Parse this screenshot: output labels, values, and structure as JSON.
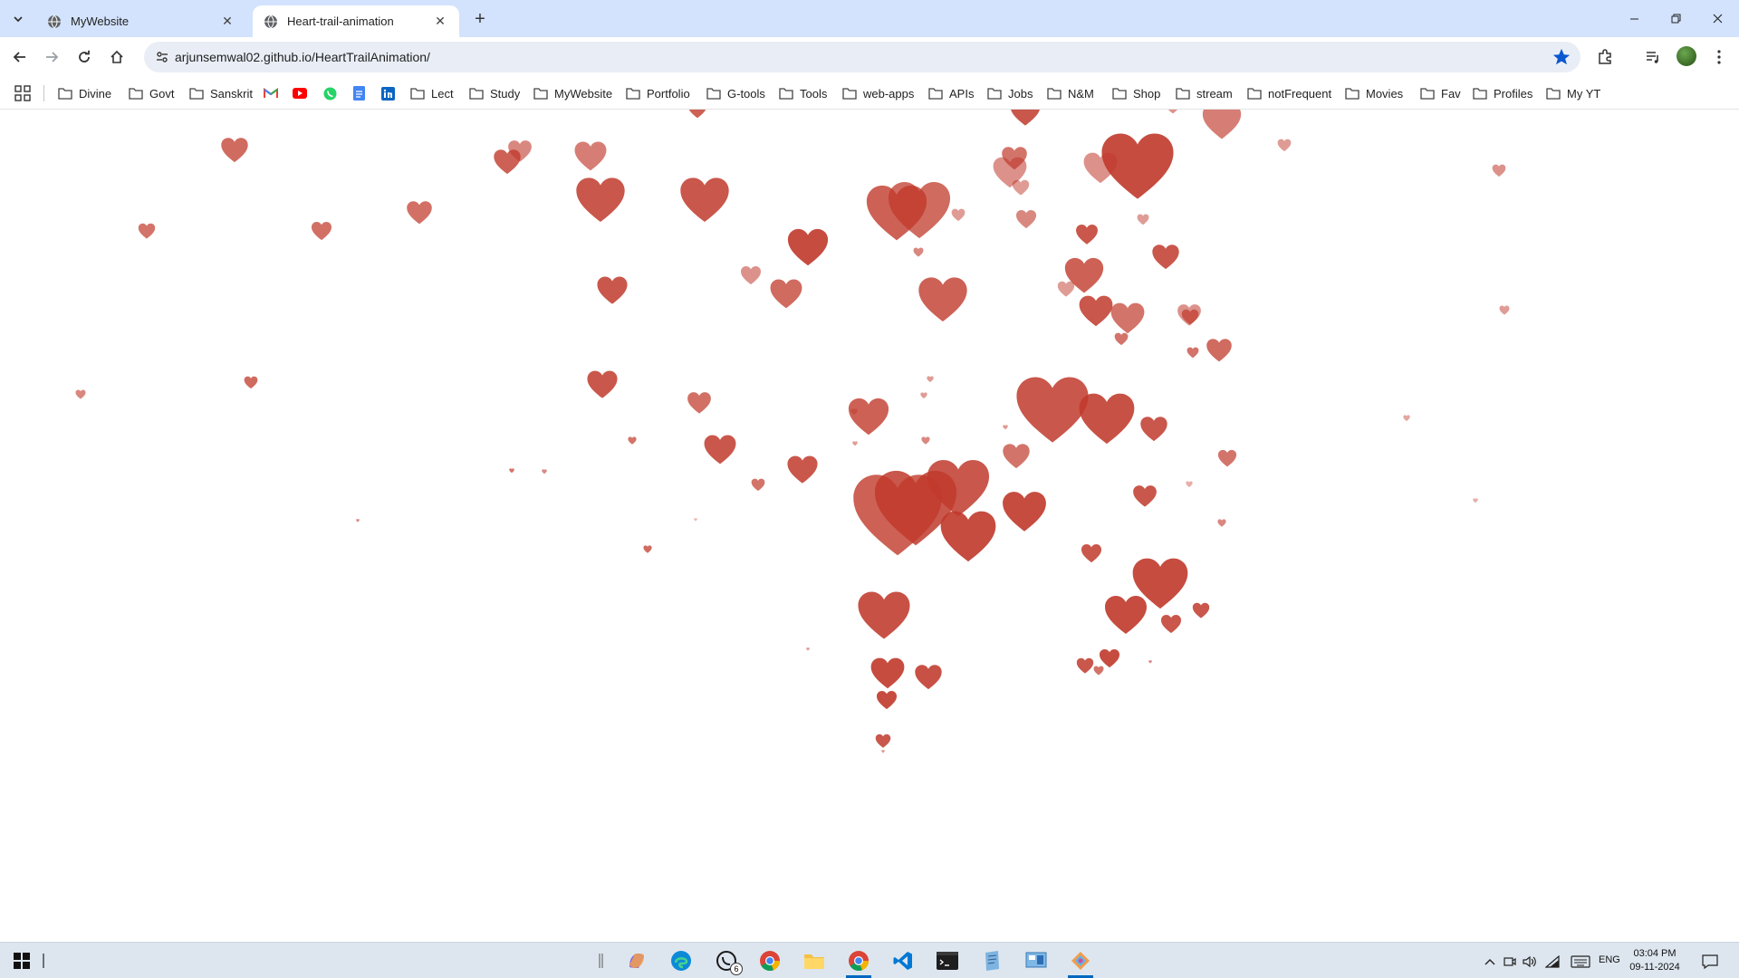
{
  "browser": {
    "tabs": [
      {
        "title": "MyWebsite",
        "active": false
      },
      {
        "title": "Heart-trail-animation",
        "active": true
      }
    ],
    "url": "arjunsemwal02.github.io/HeartTrailAnimation/",
    "bookmarks": [
      {
        "label": "Divine",
        "type": "folder"
      },
      {
        "label": "Govt",
        "type": "folder"
      },
      {
        "label": "Sanskrit",
        "type": "folder"
      },
      {
        "label": "Lect",
        "type": "folder"
      },
      {
        "label": "Study",
        "type": "folder"
      },
      {
        "label": "MyWebsite",
        "type": "folder"
      },
      {
        "label": "Portfolio",
        "type": "folder"
      },
      {
        "label": "G-tools",
        "type": "folder"
      },
      {
        "label": "Tools",
        "type": "folder"
      },
      {
        "label": "web-apps",
        "type": "folder"
      },
      {
        "label": "APIs",
        "type": "folder"
      },
      {
        "label": "Jobs",
        "type": "folder"
      },
      {
        "label": "N&M",
        "type": "folder"
      },
      {
        "label": "Shop",
        "type": "folder"
      },
      {
        "label": "stream",
        "type": "folder"
      },
      {
        "label": "notFrequent",
        "type": "folder"
      },
      {
        "label": "Movies",
        "type": "folder"
      },
      {
        "label": "Fav",
        "type": "folder"
      },
      {
        "label": "Profiles",
        "type": "folder"
      },
      {
        "label": "My YT",
        "type": "folder"
      }
    ],
    "bookmark_icons": [
      "gmail-icon",
      "youtube-icon",
      "whatsapp-icon",
      "google-docs-icon",
      "linkedin-icon"
    ]
  },
  "page": {
    "heart_color": "#c0392b",
    "background": "#ffffff"
  },
  "taskbar": {
    "whatsapp_badge": "6",
    "language": "ENG",
    "time": "03:04 PM",
    "date": "09-11-2024"
  },
  "colors": {
    "tabstrip": "#d3e3fd",
    "omnibox": "#e9eef6",
    "star": "#0b57d0",
    "taskbar": "#dde6ef"
  }
}
